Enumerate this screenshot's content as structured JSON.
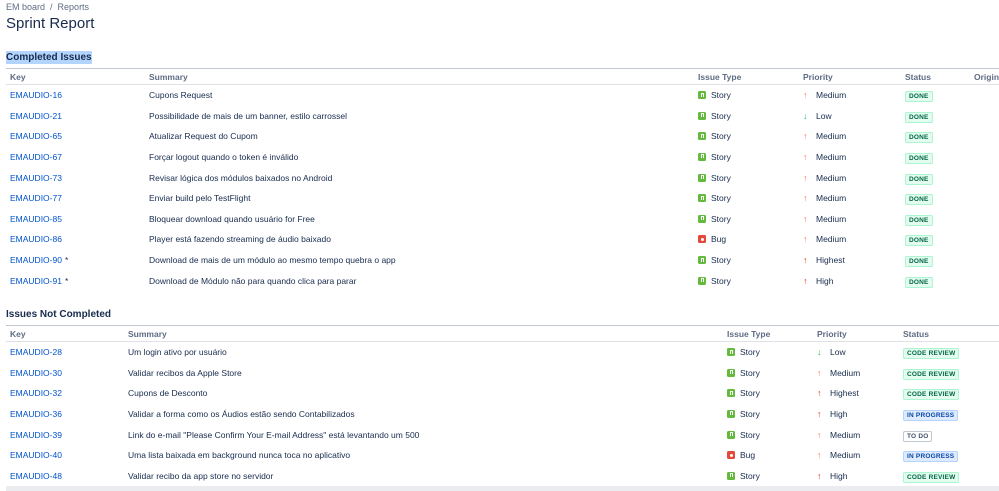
{
  "breadcrumb": {
    "board": "EM board",
    "separator": "/",
    "current": "Reports"
  },
  "page_title": "Sprint Report",
  "colors": {
    "story": "#63ba3c",
    "bug": "#e5493a",
    "link": "#0052cc",
    "priority_up": "#ff7452",
    "priority_highest": "#de350b",
    "priority_low": "#36b37e"
  },
  "completed": {
    "title": "Completed Issues",
    "headers": {
      "key": "Key",
      "summary": "Summary",
      "type": "Issue Type",
      "priority": "Priority",
      "status": "Status",
      "origin": "Origin"
    },
    "rows": [
      {
        "key": "EMAUDIO-16",
        "star": "",
        "summary": "Cupons Request",
        "type": "Story",
        "type_icon": "story-icon",
        "priority": "Medium",
        "prio_icon": "arrow-up-icon",
        "status": "DONE",
        "status_style": "green"
      },
      {
        "key": "EMAUDIO-21",
        "star": "",
        "summary": "Possibilidade de mais de um banner, estilo carrossel",
        "type": "Story",
        "type_icon": "story-icon",
        "priority": "Low",
        "prio_icon": "arrow-down-icon",
        "status": "DONE",
        "status_style": "green"
      },
      {
        "key": "EMAUDIO-65",
        "star": "",
        "summary": "Atualizar Request do Cupom",
        "type": "Story",
        "type_icon": "story-icon",
        "priority": "Medium",
        "prio_icon": "arrow-up-icon",
        "status": "DONE",
        "status_style": "green"
      },
      {
        "key": "EMAUDIO-67",
        "star": "",
        "summary": "Forçar logout quando o token é inválido",
        "type": "Story",
        "type_icon": "story-icon",
        "priority": "Medium",
        "prio_icon": "arrow-up-icon",
        "status": "DONE",
        "status_style": "green"
      },
      {
        "key": "EMAUDIO-73",
        "star": "",
        "summary": "Revisar lógica dos módulos baixados no Android",
        "type": "Story",
        "type_icon": "story-icon",
        "priority": "Medium",
        "prio_icon": "arrow-up-icon",
        "status": "DONE",
        "status_style": "green"
      },
      {
        "key": "EMAUDIO-77",
        "star": "",
        "summary": "Enviar build pelo TestFlight",
        "type": "Story",
        "type_icon": "story-icon",
        "priority": "Medium",
        "prio_icon": "arrow-up-icon",
        "status": "DONE",
        "status_style": "green"
      },
      {
        "key": "EMAUDIO-85",
        "star": "",
        "summary": "Bloquear download quando usuário for Free",
        "type": "Story",
        "type_icon": "story-icon",
        "priority": "Medium",
        "prio_icon": "arrow-up-icon",
        "status": "DONE",
        "status_style": "green"
      },
      {
        "key": "EMAUDIO-86",
        "star": "",
        "summary": "Player está fazendo streaming de áudio baixado",
        "type": "Bug",
        "type_icon": "bug-icon",
        "priority": "Medium",
        "prio_icon": "arrow-up-icon",
        "status": "DONE",
        "status_style": "green"
      },
      {
        "key": "EMAUDIO-90",
        "star": "*",
        "summary": "Download de mais de um módulo ao mesmo tempo quebra o app",
        "type": "Story",
        "type_icon": "story-icon",
        "priority": "Highest",
        "prio_icon": "arrow-up-highest-icon",
        "status": "DONE",
        "status_style": "green"
      },
      {
        "key": "EMAUDIO-91",
        "star": "*",
        "summary": "Download de Módulo não para quando clica para parar",
        "type": "Story",
        "type_icon": "story-icon",
        "priority": "High",
        "prio_icon": "arrow-up-high-icon",
        "status": "DONE",
        "status_style": "green"
      }
    ]
  },
  "not_completed": {
    "title": "Issues Not Completed",
    "headers": {
      "key": "Key",
      "summary": "Summary",
      "type": "Issue Type",
      "priority": "Priority",
      "status": "Status"
    },
    "rows": [
      {
        "key": "EMAUDIO-28",
        "star": "",
        "summary": "Um login ativo por usuário",
        "type": "Story",
        "type_icon": "story-icon",
        "priority": "Low",
        "prio_icon": "arrow-down-icon",
        "status": "CODE REVIEW",
        "status_style": "green"
      },
      {
        "key": "EMAUDIO-30",
        "star": "",
        "summary": "Validar recibos da Apple Store",
        "type": "Story",
        "type_icon": "story-icon",
        "priority": "Medium",
        "prio_icon": "arrow-up-icon",
        "status": "CODE REVIEW",
        "status_style": "green"
      },
      {
        "key": "EMAUDIO-32",
        "star": "",
        "summary": "Cupons de Desconto",
        "type": "Story",
        "type_icon": "story-icon",
        "priority": "Highest",
        "prio_icon": "arrow-up-highest-icon",
        "status": "CODE REVIEW",
        "status_style": "green"
      },
      {
        "key": "EMAUDIO-36",
        "star": "",
        "summary": "Validar a forma como os Áudios estão sendo Contabilizados",
        "type": "Story",
        "type_icon": "story-icon",
        "priority": "High",
        "prio_icon": "arrow-up-high-icon",
        "status": "IN PROGRESS",
        "status_style": "blue"
      },
      {
        "key": "EMAUDIO-39",
        "star": "",
        "summary": "Link do e-mail \"Please Confirm Your E-mail Address\" está levantando um 500",
        "type": "Story",
        "type_icon": "story-icon",
        "priority": "Medium",
        "prio_icon": "arrow-up-icon",
        "status": "TO DO",
        "status_style": "grey"
      },
      {
        "key": "EMAUDIO-40",
        "star": "",
        "summary": "Uma lista baixada em background nunca toca no aplicativo",
        "type": "Bug",
        "type_icon": "bug-icon",
        "priority": "Medium",
        "prio_icon": "arrow-up-icon",
        "status": "IN PROGRESS",
        "status_style": "blue"
      },
      {
        "key": "EMAUDIO-48",
        "star": "",
        "summary": "Validar recibo da app store no servidor",
        "type": "Story",
        "type_icon": "story-icon",
        "priority": "High",
        "prio_icon": "arrow-up-high-icon",
        "status": "CODE REVIEW",
        "status_style": "green"
      }
    ]
  }
}
